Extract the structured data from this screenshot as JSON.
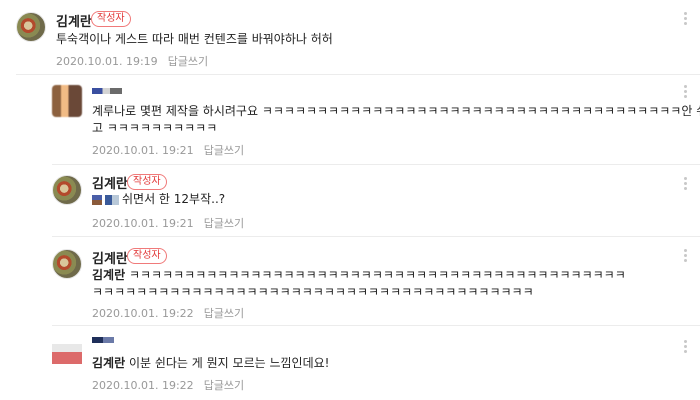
{
  "comments": [
    {
      "author": "김계란",
      "badge": "작성자",
      "text": "투숙객이나 게스트 따라 매번 컨텐즈를 바꿔야하나 허허",
      "date": "2020.10.01. 19:19",
      "reply_label": "답글쓰기"
    },
    {
      "author": "",
      "text_line1": "계루나로 몇편 제작을 하시려구요 ㅋㅋㅋㅋㅋㅋㅋㅋㅋㅋㅋㅋㅋㅋㅋㅋㅋㅋㅋㅋㅋㅋㅋㅋㅋㅋㅋㅋㅋㅋㅋㅋㅋㅋㅋㅋㅋㅋ안 쉬냐",
      "text_line2": "고 ㅋㅋㅋㅋㅋㅋㅋㅋㅋㅋ",
      "date": "2020.10.01. 19:21",
      "reply_label": "답글쓰기"
    },
    {
      "author": "김계란",
      "badge": "작성자",
      "text": "쉬면서 한 12부작..?",
      "date": "2020.10.01. 19:21",
      "reply_label": "답글쓰기"
    },
    {
      "author": "김계란",
      "badge": "작성자",
      "mention": "김계란",
      "text_line1": "ㅋㅋㅋㅋㅋㅋㅋㅋㅋㅋㅋㅋㅋㅋㅋㅋㅋㅋㅋㅋㅋㅋㅋㅋㅋㅋㅋㅋㅋㅋㅋㅋㅋㅋㅋㅋㅋㅋㅋㅋㅋㅋㅋㅋㅋ",
      "text_line2": "ㅋㅋㅋㅋㅋㅋㅋㅋㅋㅋㅋㅋㅋㅋㅋㅋㅋㅋㅋㅋㅋㅋㅋㅋㅋㅋㅋㅋㅋㅋㅋㅋㅋㅋㅋㅋㅋㅋㅋㅋ",
      "date": "2020.10.01. 19:22",
      "reply_label": "답글쓰기"
    },
    {
      "author": "",
      "mention": "김계란",
      "text": "이분 쉰다는 게 뭔지 모르는 느낌인데요!",
      "date": "2020.10.01. 19:22",
      "reply_label": "답글쓰기"
    }
  ],
  "colors": {
    "badge": "#e23a3a",
    "meta": "#999999",
    "separator": "#ececec"
  }
}
